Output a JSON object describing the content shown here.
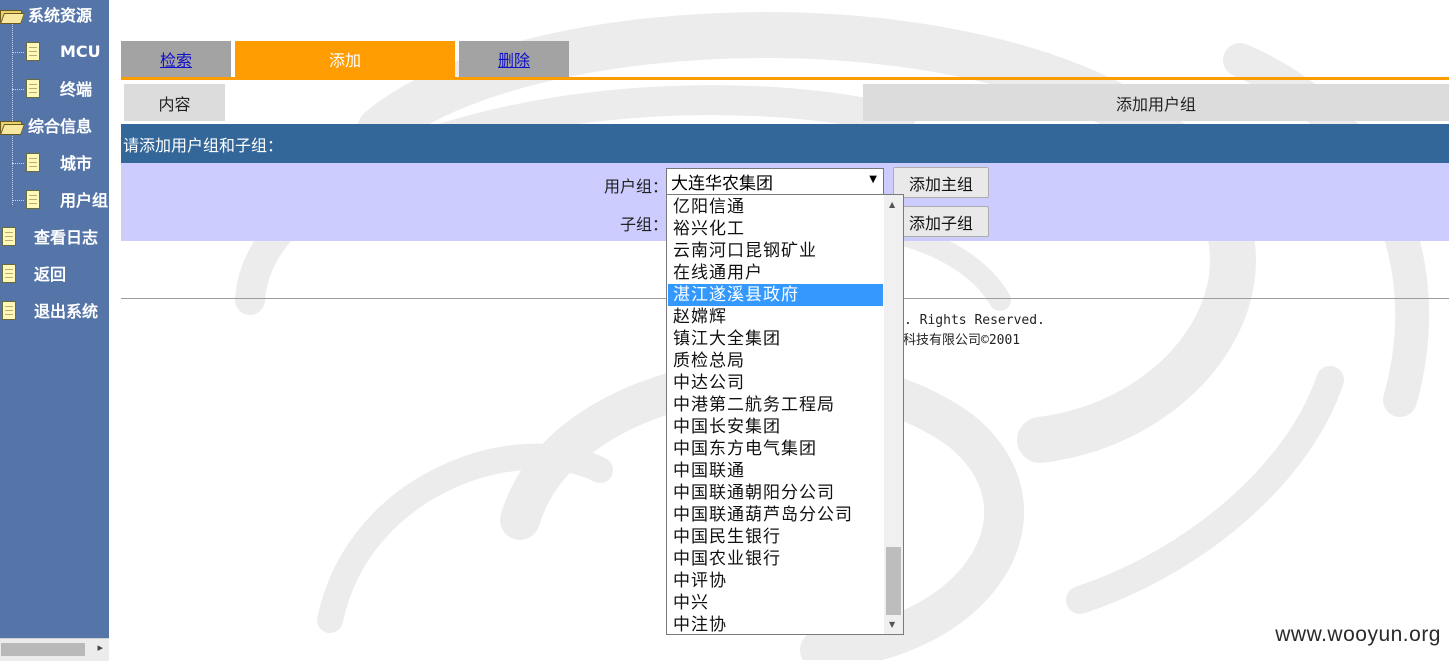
{
  "sidebar": {
    "items": [
      {
        "label": "系统资源",
        "icon": "folder-icon"
      },
      {
        "label": "MCU",
        "icon": "document-icon"
      },
      {
        "label": "终端",
        "icon": "document-icon"
      },
      {
        "label": "综合信息",
        "icon": "folder-icon"
      },
      {
        "label": "城市",
        "icon": "document-icon"
      },
      {
        "label": "用户组",
        "icon": "document-icon"
      },
      {
        "label": "查看日志",
        "icon": "document-icon"
      },
      {
        "label": "返回",
        "icon": "document-icon"
      },
      {
        "label": "退出系统",
        "icon": "document-icon"
      }
    ]
  },
  "tabs": [
    {
      "label": "检索",
      "state": "link"
    },
    {
      "label": "添加",
      "state": "active"
    },
    {
      "label": "删除",
      "state": "link"
    }
  ],
  "info": {
    "left": "内容",
    "right": "添加用户组"
  },
  "prompt": "请添加用户组和子组：",
  "form": {
    "group_label": "用户组：",
    "group_selected": "大连华农集团",
    "add_main_button": "添加主组",
    "sub_label": "子组：",
    "add_sub_button": "添加子组"
  },
  "dropdown": {
    "options": [
      "亿阳信通",
      "裕兴化工",
      "云南河口昆钢矿业",
      "在线通用户",
      "湛江遂溪县政府",
      "赵嫦辉",
      "镇江大全集团",
      "质检总局",
      "中达公司",
      "中港第二航务工程局",
      "中国长安集团",
      "中国东方电气集团",
      "中国联通",
      "中国联通朝阳分公司",
      "中国联通葫芦岛分公司",
      "中国民生银行",
      "中国农业银行",
      "中评协",
      "中兴",
      "中注协"
    ],
    "highlighted": "湛江遂溪县政府"
  },
  "footer": {
    "line1": ". Rights Reserved.",
    "line2": "科技有限公司©2001"
  },
  "watermark": "www.wooyun.org",
  "colors": {
    "sidebar_bg": "#5575a8",
    "tab_active": "#ff9c00",
    "tab_inactive": "#a3a3a3",
    "prompt_bar": "#336699",
    "form_bg": "#ccccff",
    "highlight": "#3399ff"
  }
}
